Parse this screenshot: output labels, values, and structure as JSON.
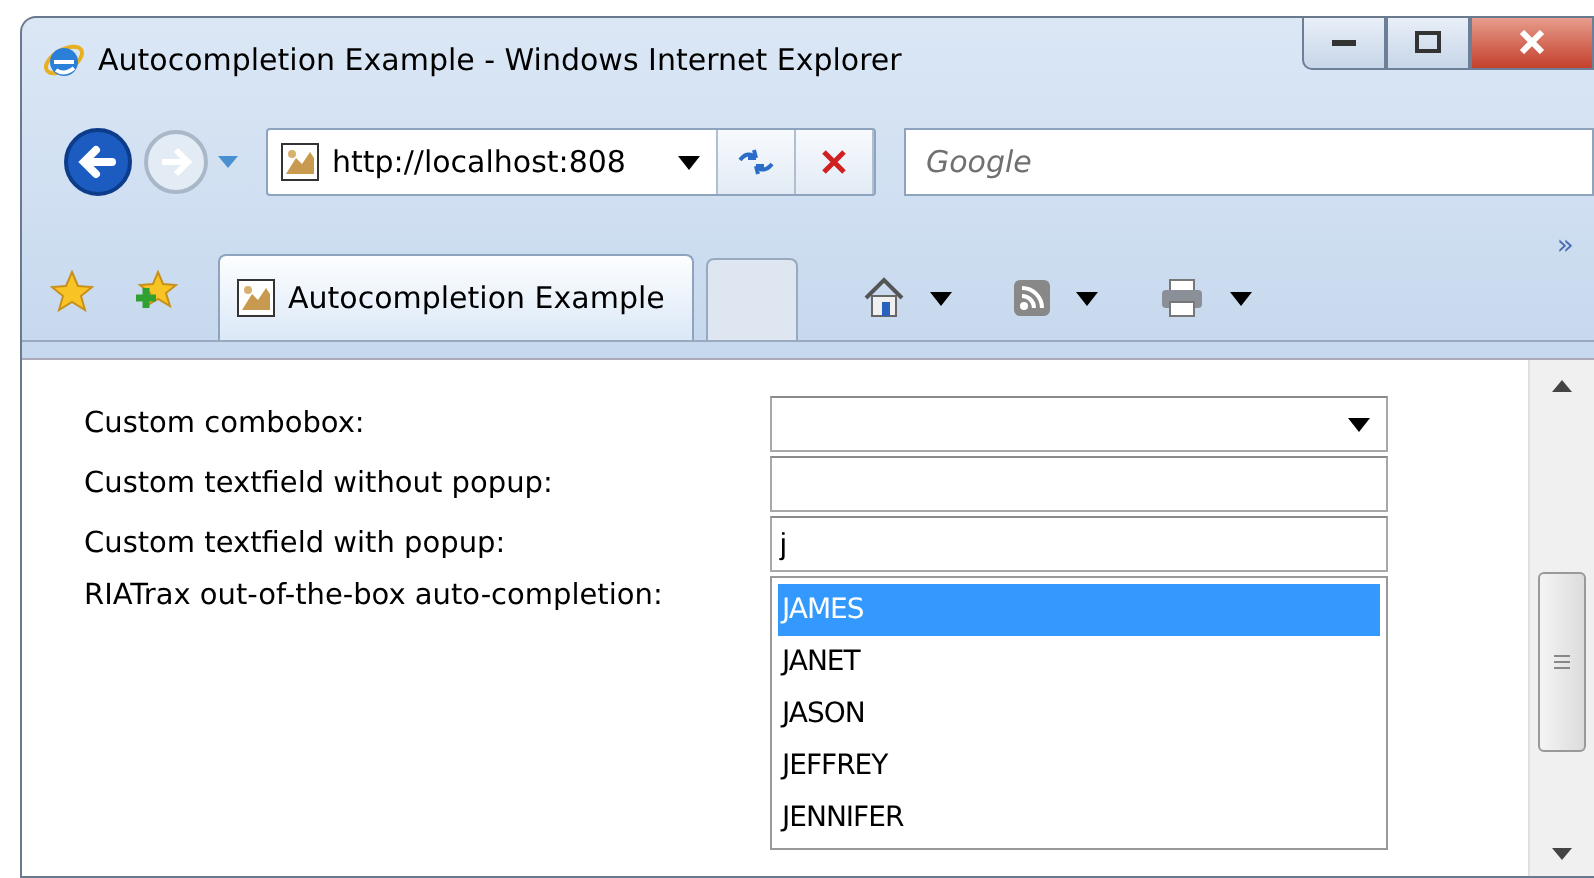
{
  "window": {
    "title": "Autocompletion Example - Windows Internet Explorer"
  },
  "address_bar": {
    "value": "http://localhost:808"
  },
  "search": {
    "placeholder": "Google"
  },
  "tabs": [
    {
      "label": "Autocompletion Example",
      "selected": true
    }
  ],
  "toolbar_overflow": "»",
  "form": [
    {
      "kind": "combobox",
      "label": "Custom combobox:"
    },
    {
      "kind": "textfield",
      "label": "Custom textfield without popup:"
    },
    {
      "kind": "textfield",
      "label": "Custom textfield with popup:",
      "value": "j"
    },
    {
      "kind": "list",
      "label": "RIATrax out-of-the-box auto-completion:",
      "items": [
        {
          "text": "JAMES",
          "selected": true
        },
        {
          "text": "JANET",
          "selected": false
        },
        {
          "text": "JASON",
          "selected": false
        },
        {
          "text": "JEFFREY",
          "selected": false
        },
        {
          "text": "JENNIFER",
          "selected": false
        }
      ]
    }
  ]
}
